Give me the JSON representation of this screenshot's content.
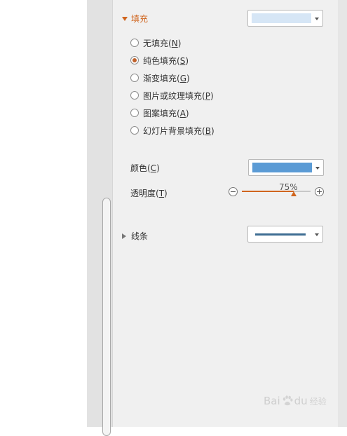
{
  "fill_section": {
    "title": "填充",
    "swatch_color": "#d6e6f6",
    "options": [
      {
        "label": "无填充",
        "key": "N",
        "checked": false
      },
      {
        "label": "纯色填充",
        "key": "S",
        "checked": true
      },
      {
        "label": "渐变填充",
        "key": "G",
        "checked": false
      },
      {
        "label": "图片或纹理填充",
        "key": "P",
        "checked": false
      },
      {
        "label": "图案填充",
        "key": "A",
        "checked": false
      },
      {
        "label": "幻灯片背景填充",
        "key": "B",
        "checked": false
      }
    ]
  },
  "color_field": {
    "label": "颜色",
    "key": "C",
    "value_color": "#5b9bd5"
  },
  "transparency": {
    "label": "透明度",
    "key": "T",
    "value_text": "75%",
    "value_fraction": 0.75
  },
  "line_section": {
    "title": "线条",
    "line_color": "#3e6d93"
  },
  "watermark": {
    "brand": "Bai",
    "brand2": "du",
    "sub": "经验"
  }
}
